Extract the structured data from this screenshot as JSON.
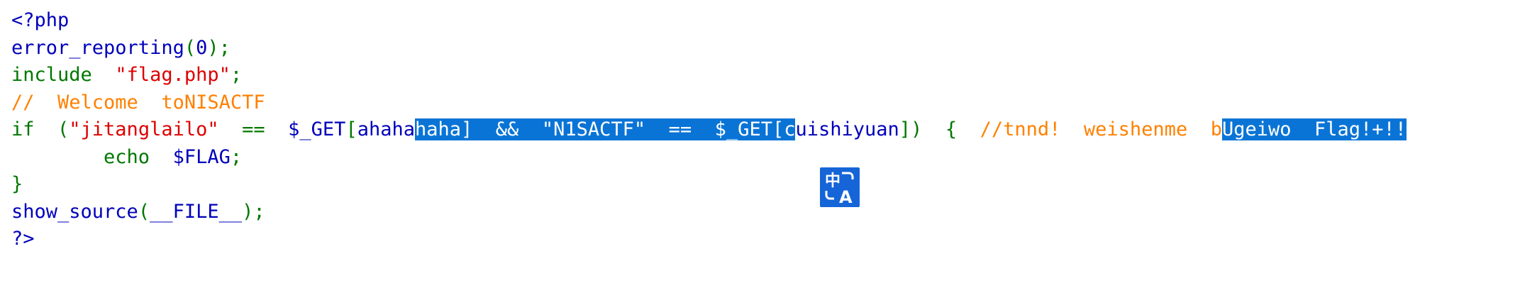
{
  "source": {
    "lines": [
      [
        {
          "t": "<?php",
          "c": "def"
        }
      ],
      [
        {
          "t": "error_reporting",
          "c": "def"
        },
        {
          "t": "(",
          "c": "kw"
        },
        {
          "t": "0",
          "c": "def"
        },
        {
          "t": ");",
          "c": "kw"
        }
      ],
      [
        {
          "t": "include  ",
          "c": "kw"
        },
        {
          "t": "\"flag.php\"",
          "c": "str"
        },
        {
          "t": ";",
          "c": "kw"
        }
      ],
      [
        {
          "t": "//  Welcome  toNISACTF",
          "c": "cm"
        }
      ],
      [
        {
          "t": "if  (",
          "c": "kw"
        },
        {
          "t": "\"jitanglailo\"",
          "c": "str"
        },
        {
          "t": "  ==  ",
          "c": "kw"
        },
        {
          "t": "$_GET",
          "c": "def"
        },
        {
          "t": "[",
          "c": "kw"
        },
        {
          "t": "ahaha",
          "c": "def"
        },
        {
          "t": "haha",
          "c": "def",
          "sel": true
        },
        {
          "t": "]  &&  ",
          "c": "kw",
          "sel": true
        },
        {
          "t": "\"N1SACTF\"",
          "c": "str",
          "sel": true
        },
        {
          "t": "  ==  ",
          "c": "kw",
          "sel": true
        },
        {
          "t": "$_GET",
          "c": "def",
          "sel": true
        },
        {
          "t": "[",
          "c": "kw",
          "sel": true
        },
        {
          "t": "c",
          "c": "def",
          "sel": true
        },
        {
          "t": "uishiyuan",
          "c": "def"
        },
        {
          "t": "])  {  ",
          "c": "kw"
        },
        {
          "t": "//tnnd!  weishenme  b",
          "c": "cm"
        },
        {
          "t": "Ugeiwo  Flag!+!!",
          "c": "cm",
          "sel": true
        }
      ],
      [
        {
          "t": "        echo  ",
          "c": "kw"
        },
        {
          "t": "$FLAG",
          "c": "def"
        },
        {
          "t": ";",
          "c": "kw"
        }
      ],
      [
        {
          "t": "}",
          "c": "kw"
        }
      ],
      [
        {
          "t": "show_source",
          "c": "def"
        },
        {
          "t": "(",
          "c": "kw"
        },
        {
          "t": "__FILE__",
          "c": "def"
        },
        {
          "t": ");",
          "c": "kw"
        }
      ],
      [
        {
          "t": "?>",
          "c": "def"
        }
      ]
    ]
  },
  "translate_button": {
    "icon": "translate-icon",
    "glyph_zh": "中",
    "glyph_a": "A"
  },
  "colors": {
    "default": "#0000bb",
    "keyword": "#007700",
    "string": "#dd0000",
    "comment": "#ff8000",
    "selection": "#0a74d6",
    "translate_bg": "#1565d8"
  }
}
